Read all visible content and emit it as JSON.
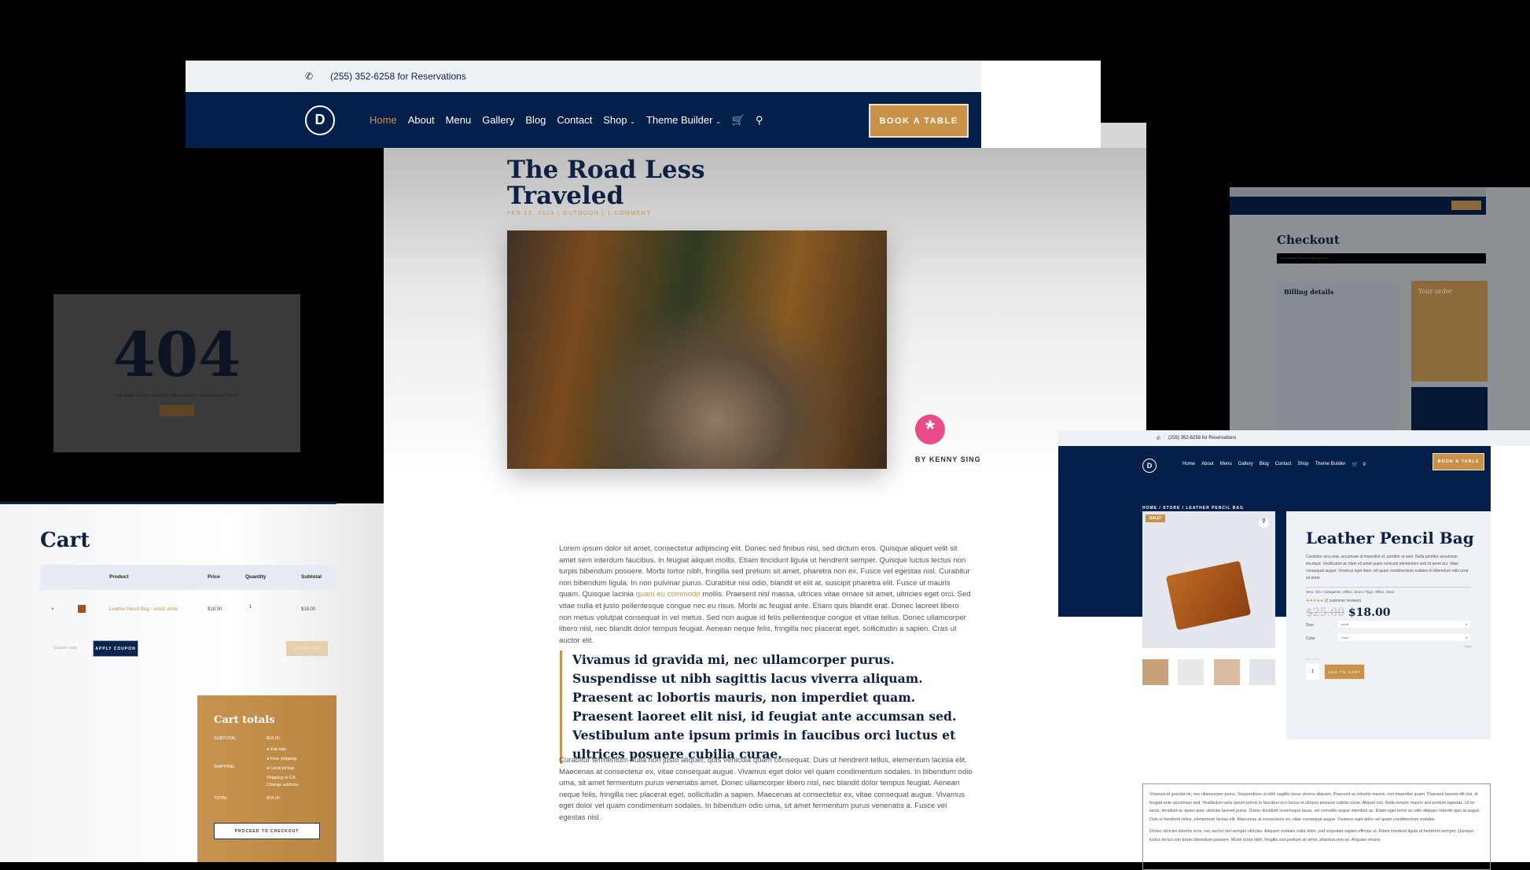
{
  "header": {
    "phone_icon": "phone-icon",
    "phone": "(255) 352-6258 for Reservations",
    "logo": "D",
    "nav": [
      "Home",
      "About",
      "Menu",
      "Gallery",
      "Blog",
      "Contact",
      "Shop",
      "Theme Builder"
    ],
    "cart_icon": "cart-icon",
    "search_icon": "search-icon",
    "book_label": "BOOK A TABLE",
    "active_color": "#c9924a",
    "brand_navy": "#04204a",
    "brand_gold": "#c9924a"
  },
  "post": {
    "title_line1": "The Road Less",
    "title_line2": "Traveled",
    "meta": "FEB 12, 2018 | OUTDOOR | 1 COMMENT",
    "author": "BY KENNY SING",
    "p1_before": "Lorem ipsum dolor sit amet, consectetur adipiscing elit. Donec sed finibus nisi, sed dictum eros. Quisque aliquet velit sit amet sem interdum faucibus. In feugiat aliquet mollis. Etiam tincidunt ligula ut hendrerit semper. Quisque luctus lectus non turpis bibendum posuere. Morbi tortor nibh, fringilla sed pretium sit amet, pharetra non ex. Fusce vel egestas nisl. Curabitur non bibendum ligula. In non pulvinar purus. Curabitur nisi odio, blandit et elit at, suscipit pharetra elit. Fusce ut mauris quam. Quisque lacinia ",
    "p1_link": "quam eu commodo",
    "p1_after": " mollis. Praesent nisl massa, ultrices vitae ornare sit amet, ultricies eget orci. Sed vitae nulla et justo pellentesque congue nec eu risus. Morbi ac feugiat ante. Etiam quis blandit erat. Donec laoreet libero non metus volutpat consequat in vel metus. Sed non augue id felis pellentesque congue et vitae tellus. Donec ullamcorper libero nisl, nec blandit dolor tempus feugiat. Aenean neque felis, fringilla nec placerat eget, sollicitudin a sapien. Cras ut auctor elit.",
    "quote": "Vivamus id gravida mi, nec ullamcorper purus. Suspendisse ut nibh sagittis lacus viverra aliquam. Praesent ac lobortis mauris, non imperdiet quam. Praesent laoreet elit nisi, id feugiat ante accumsan sed. Vestibulum ante ipsum primis in faucibus orci luctus et ultrices posuere cubilia curae.",
    "p2": "Curabitur fermentum nulla non justo aliquet, quis vehicula quam consequat. Duis ut hendrerit tellus, elementum lacinia elit. Maecenas at consectetur ex, vitae consequat augue. Vivamus eget dolor vel quam condimentum sodales. In bibendum odio urna, sit amet fermentum purus venenatis amet. Donec ullamcorper libero nisl, nec blandit dolor tempus feugiat. Aenean neque felis, fringilla nec placerat eget, sollicitudin a sapien. Maecenas at consectetur ex, vitae consequat augue. Vivamus eget dolor vel quam condimentum sodales. In bibendum odio urna, sit amet fermentum purus venenatis a. Fusce vel egestas nisl."
  },
  "error": {
    "code": "404",
    "message": "THE PAGE YOU'RE LOOKING FOR IS BROKEN OR DOES NOT EXIST"
  },
  "cart": {
    "title": "Cart",
    "headers": [
      "Product",
      "Price",
      "Quantity",
      "Subtotal"
    ],
    "row": {
      "remove": "×",
      "product": "Leather Pencil Bag - small, white",
      "price": "$18.00",
      "qty": "1",
      "subtotal": "$18.00"
    },
    "coupon_placeholder": "Coupon code",
    "apply": "APPLY COUPON",
    "update": "UPDATE CART",
    "totals": {
      "title": "Cart totals",
      "subtotal_label": "SUBTOTAL",
      "subtotal": "$18.00",
      "shipping_label": "SHIPPING",
      "options": [
        "Flat rate",
        "Free shipping",
        "Local pickup"
      ],
      "ship_to": "Shipping to CA.",
      "change": "Change address",
      "total_label": "TOTAL",
      "total": "$18.00",
      "proceed": "PROCEED TO CHECKOUT"
    }
  },
  "checkout": {
    "title": "Checkout",
    "coupon_notice": "Have a coupon? Click here to enter your code",
    "billing": "Billing details",
    "order": "Your order"
  },
  "product": {
    "breadcrumb": "HOME / STORE / LEATHER PENCIL BAG",
    "sale": "SALE!",
    "title": "Leather Pencil Bag",
    "desc": "Curabitur arcu erat, accumsan id imperdiet et, porttitor at sem. Nulla porttitor accumsan tincidunt. Vestibulum ac diam sit amet quam vehicula elementum sed sit amet dui. Vitae consequat augue. Vivamus eget dolor vel quam condimentum sodales in bibendum odio urna sit amet.",
    "meta": "SKU: N/A / Categories: Office, Store / Tags: Office, Store",
    "rating": 5,
    "reviews": "(2 customer reviews)",
    "old_price": "$25.00",
    "price": "$18.00",
    "size_label": "Size",
    "size": "small",
    "color_label": "Color",
    "color": "white",
    "clear": "Clear",
    "stock": "8 in stock",
    "qty": "1",
    "add": "ADD TO CART",
    "long1": "Vivamus id gravida mi, nec ullamcorper purus. Suspendisse ut nibh sagittis lacus viverra aliquam. Praesent ac lobortis mauris, non imperdiet quam. Praesent laoreet elit nisi, id feugiat ante accumsan sed. Vestibulum ante ipsum primis in faucibus orci luctus et ultrices posuere cubilia curae. Aliquet nisl. Nulla tempor mauris sed pretium egestas. Ut mi lacus, tincidunt ac quam quis, ultricies laoreet purus. Donec tincidunt scelerisque lacus, vel convallis augue interdum ac. Etiam eget tortor ac odio aliquam lobortis quis at augue. Duis ut hendrerit tellus, elementum lacinia elit. Maecenas at consectetur ex, vitae consequat augue. Vivamus eget dolor vel quam condimentum sodales.",
    "long2": "Donec ultricies lobortis eros, nec auctor nisl semper ultricies. Aliquam sodales nulla dolor, sed vulputate sapien efficitur ut. Etiam tincidunt ligula ut hendrerit semper. Quisque luctus lectus non turpis bibendum posuere. Morbi tortor nibh, fringilla sed pretium sit amet, pharetra non ex. Aliquam ornare"
  }
}
